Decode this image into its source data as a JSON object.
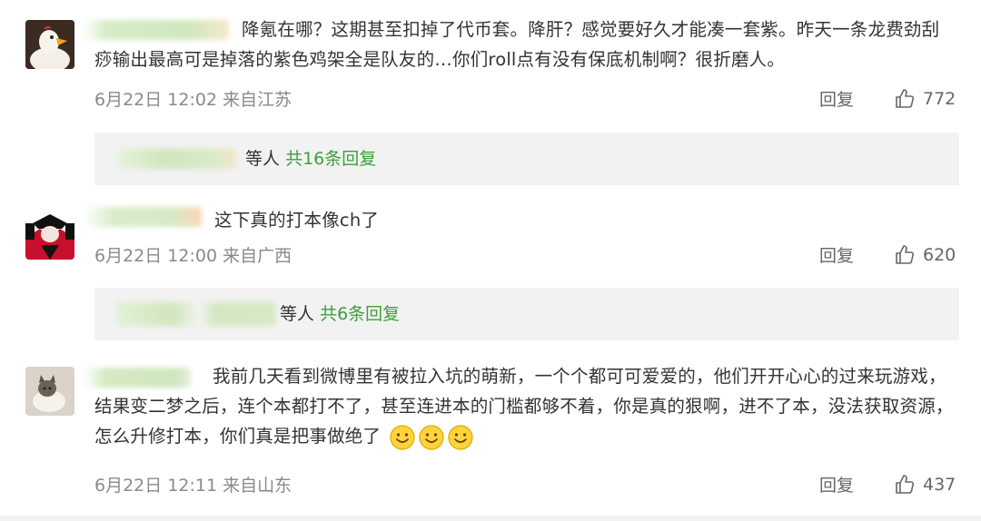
{
  "comments": [
    {
      "text": "降氪在哪？这期甚至扣掉了代币套。降肝？感觉要好久才能凑一套紫。昨天一条龙费劲刮痧输出最高可是掉落的紫色鸡架全是队友的…你们roll点有没有保底机制啊？很折磨人。",
      "time": "6月22日 12:02 来自江苏",
      "reply_label": "回复",
      "likes": "772",
      "thread": {
        "suffix": "等人",
        "count": "共16条回复"
      }
    },
    {
      "text": "这下真的打本像ch了",
      "time": "6月22日 12:00 来自广西",
      "reply_label": "回复",
      "likes": "620",
      "thread": {
        "suffix": "等人",
        "count": "共6条回复"
      }
    },
    {
      "text": "我前几天看到微博里有被拉入坑的萌新，一个个都可可爱爱的，他们开开心心的过来玩游戏，结果变二梦之后，连个本都打不了，甚至连进本的门槛都够不着，你是真的狠啊，进不了本，没法获取资源，怎么升修打本，你们真是把事做绝了",
      "time": "6月22日 12:11 来自山东",
      "reply_label": "回复",
      "likes": "437"
    }
  ],
  "icons": {
    "like": "thumbs-up-icon",
    "emoji": "smiley-face-icon"
  },
  "colors": {
    "link_green": "#3f9e3a",
    "meta_gray": "#8a8a8a",
    "thread_bg": "#f2f2f2"
  }
}
